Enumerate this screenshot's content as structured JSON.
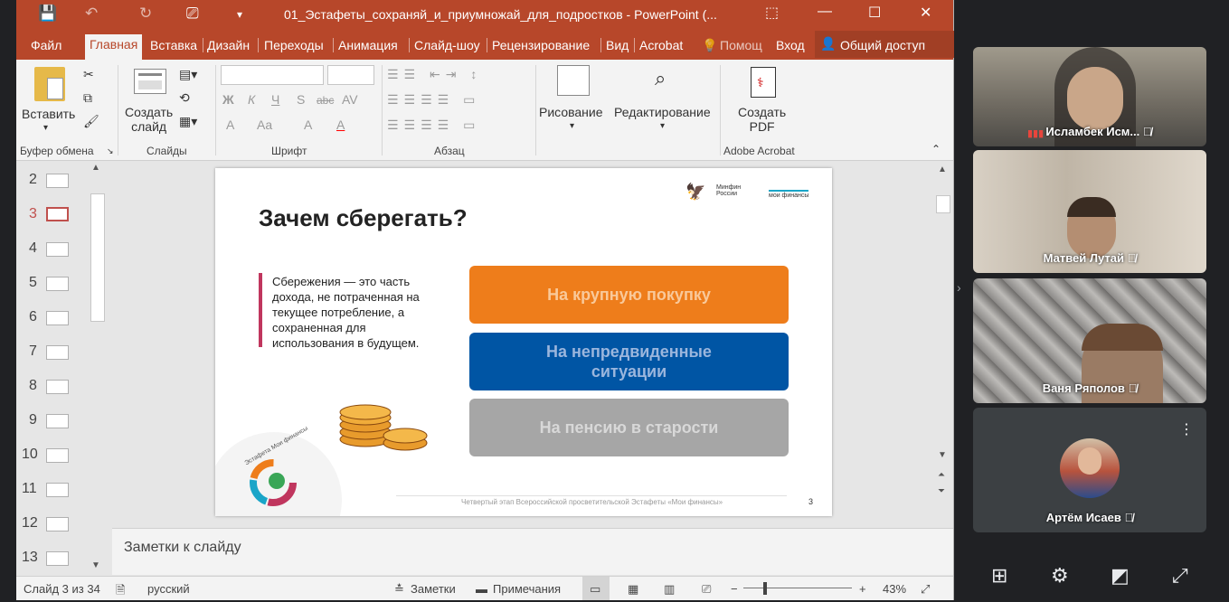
{
  "window": {
    "title": "01_Эстафеты_сохраняй_и_приумножай_для_подростков - PowerPoint (...",
    "quick_access": [
      "💾",
      "↶",
      "↻",
      "📽"
    ],
    "controls": [
      "⬚",
      "—",
      "☐",
      "✕"
    ]
  },
  "tabs": {
    "items": [
      "Файл",
      "Главная",
      "Вставка",
      "Дизайн",
      "Переходы",
      "Анимация",
      "Слайд-шоу",
      "Рецензирование",
      "Вид",
      "Acrobat"
    ],
    "tell_me": "Помощ",
    "signin": "Вход",
    "share": "Общий доступ"
  },
  "ribbon": {
    "paste": "Вставить",
    "clipboard_group": "Буфер обмена",
    "new_slide": "Создать\nслайд",
    "slides_group": "Слайды",
    "font_group": "Шрифт",
    "font_buttons": [
      "Ж",
      "К",
      "Ч",
      "S",
      "abc",
      "AV",
      "A",
      "Aa",
      "A",
      "A"
    ],
    "paragraph_group": "Абзац",
    "drawing": "Рисование",
    "editing": "Редактирование",
    "create_pdf": "Создать\nPDF",
    "acrobat_group": "Adobe Acrobat"
  },
  "thumbnails": {
    "numbers": [
      "2",
      "3",
      "4",
      "5",
      "6",
      "7",
      "8",
      "9",
      "10",
      "11",
      "12",
      "13"
    ],
    "selected": "3"
  },
  "slide": {
    "title": "Зачем сберегать?",
    "logo_minfin": "Минфин\nРоссии",
    "logo_moi": "мои финансы",
    "definition": "Сбережения — это часть дохода, не потраченная на текущее потребление, а сохраненная для использования в будущем.",
    "buttons": [
      {
        "label": "На крупную покупку",
        "color": "#ee7d1b",
        "text_color": "#f9c99a"
      },
      {
        "label": "На непредвиденные ситуации",
        "color": "#0055a4",
        "text_color": "#9bb6dd"
      },
      {
        "label": "На пенсию в старости",
        "color": "#a6a6a6",
        "text_color": "#d8d8d8"
      }
    ],
    "relay_logo": "Эстафета Мои финансы",
    "footer": "Четвертый этап Всероссийской просветительской Эстафеты «Мои финансы»",
    "page": "3"
  },
  "notes": {
    "placeholder": "Заметки к слайду"
  },
  "status": {
    "slide": "Слайд 3 из 34",
    "language": "русский",
    "notes": "Заметки",
    "comments": "Примечания",
    "zoom": "43%",
    "zoom_level": 0.43
  },
  "meet": {
    "participants": [
      {
        "name": "Исламбек Исм...",
        "status": "speaking"
      },
      {
        "name": "Матвей Лутай",
        "status": "muted"
      },
      {
        "name": "Ваня Ряполов",
        "status": "muted"
      },
      {
        "name": "Артём Исаев",
        "status": "muted"
      }
    ],
    "controls": [
      "grid-icon",
      "settings-icon",
      "pip-icon",
      "fullscreen-icon"
    ]
  }
}
